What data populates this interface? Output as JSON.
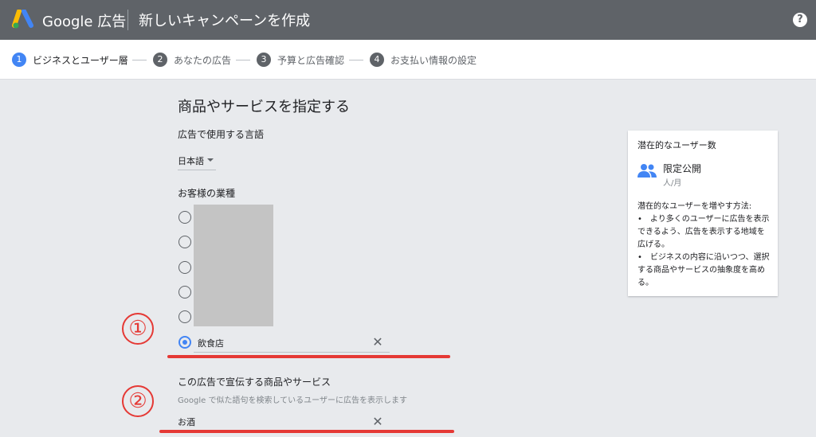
{
  "header": {
    "brand": "Google 広告",
    "title": "新しいキャンペーンを作成",
    "help_symbol": "?"
  },
  "stepper": {
    "steps": [
      {
        "number": "1",
        "label": "ビジネスとユーザー層",
        "active": true
      },
      {
        "number": "2",
        "label": "あなたの広告",
        "active": false
      },
      {
        "number": "3",
        "label": "予算と広告確認",
        "active": false
      },
      {
        "number": "4",
        "label": "お支払い情報の設定",
        "active": false
      }
    ]
  },
  "main": {
    "section_title": "商品やサービスを指定する",
    "language": {
      "label": "広告で使用する言語",
      "value": "日本語"
    },
    "business_type": {
      "label": "お客様の業種",
      "selected_value": "飲食店",
      "option_count": 6
    },
    "products": {
      "label": "この広告で宣伝する商品やサービス",
      "hint": "Google で似た語句を検索しているユーザーに広告を表示します",
      "value": "お酒"
    },
    "clear_symbol": "✕"
  },
  "annotations": {
    "marker_1": "①",
    "marker_2": "②",
    "color": "#e53935"
  },
  "side_card": {
    "title": "潜在的なユーザー数",
    "value": "限定公開",
    "unit": "人/月",
    "subtitle": "潜在的なユーザーを増やす方法:",
    "bullets": [
      "•　より多くのユーザーに広告を表示できるよう、広告を表示する地域を広げる。",
      "•　ビジネスの内容に沿いつつ、選択する商品やサービスの抽象度を高める。"
    ]
  },
  "colors": {
    "topbar": "#5f6368",
    "accent": "#4285f4",
    "background": "#e8eaed"
  }
}
